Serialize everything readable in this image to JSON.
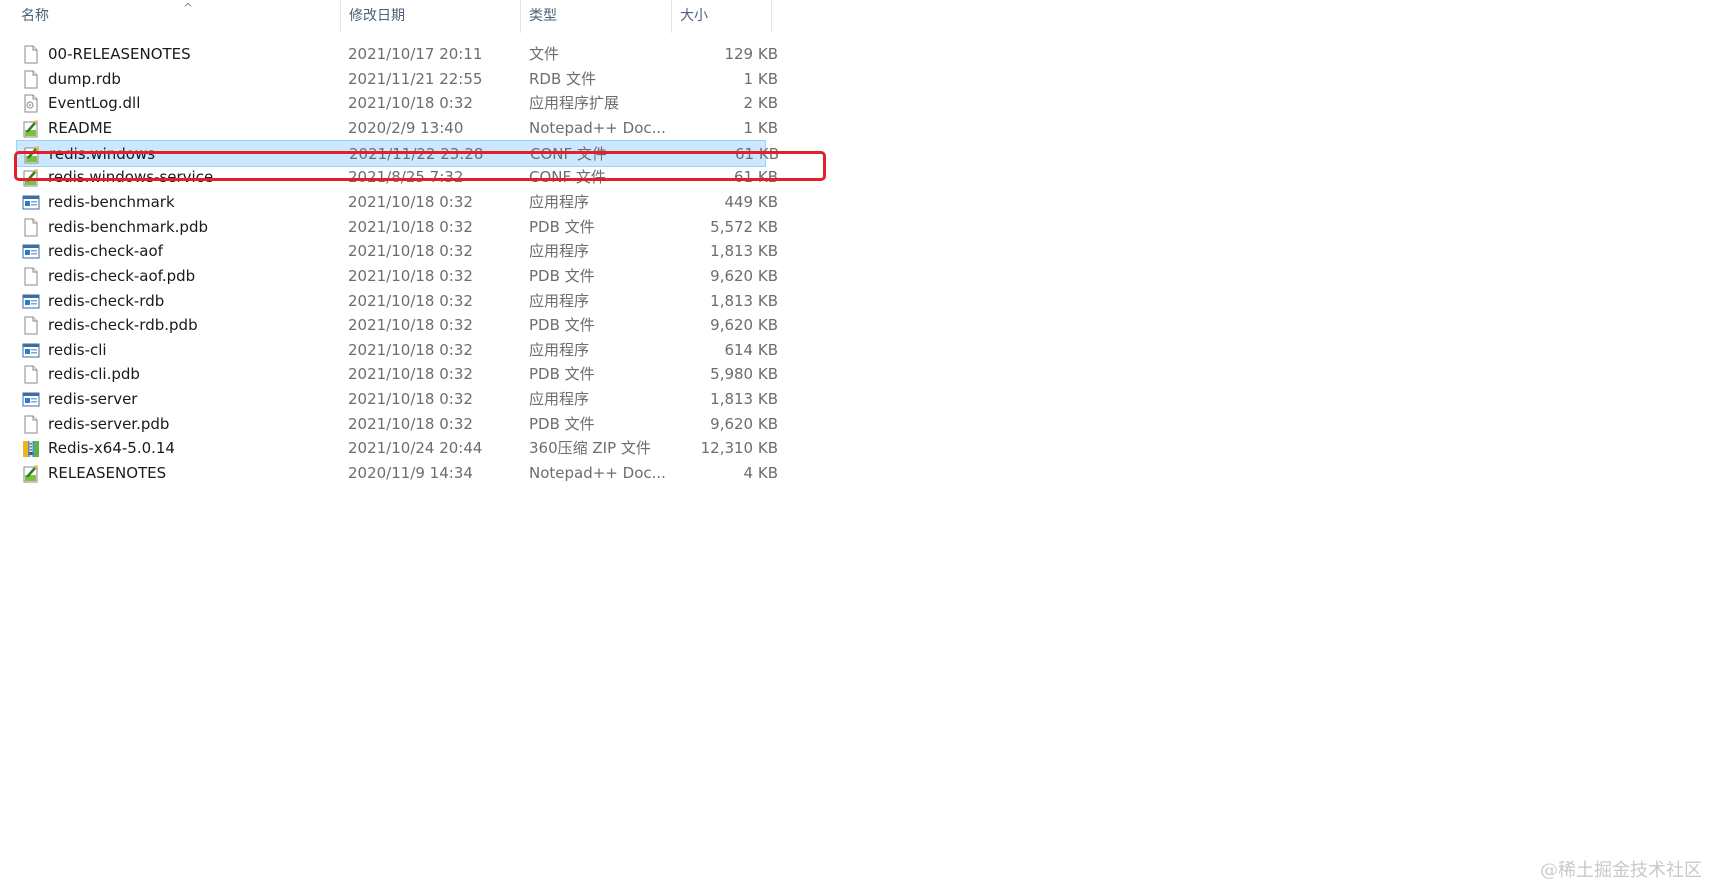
{
  "columns": {
    "name": "名称",
    "date": "修改日期",
    "type": "类型",
    "size": "大小"
  },
  "colors": {
    "selection_bg": "#cce8ff",
    "selection_border": "#99d1ff",
    "highlight_box": "#e0202a",
    "header_text": "#4c607a",
    "secondary_text": "#6d6d6d"
  },
  "files": [
    {
      "name": "00-RELEASENOTES",
      "date": "2021/10/17 20:11",
      "type": "文件",
      "size": "129 KB",
      "icon": "blank-file-icon"
    },
    {
      "name": "dump.rdb",
      "date": "2021/11/21 22:55",
      "type": "RDB 文件",
      "size": "1 KB",
      "icon": "blank-file-icon"
    },
    {
      "name": "EventLog.dll",
      "date": "2021/10/18 0:32",
      "type": "应用程序扩展",
      "size": "2 KB",
      "icon": "dll-file-icon"
    },
    {
      "name": "README",
      "date": "2020/2/9 13:40",
      "type": "Notepad++ Doc...",
      "size": "1 KB",
      "icon": "notepad-plus-plus-file-icon"
    },
    {
      "name": "redis.windows",
      "date": "2021/11/22 23:28",
      "type": "CONF 文件",
      "size": "61 KB",
      "icon": "notepad-plus-plus-file-icon",
      "selected": true
    },
    {
      "name": "redis.windows-service",
      "date": "2021/8/25 7:32",
      "type": "CONF 文件",
      "size": "61 KB",
      "icon": "notepad-plus-plus-file-icon"
    },
    {
      "name": "redis-benchmark",
      "date": "2021/10/18 0:32",
      "type": "应用程序",
      "size": "449 KB",
      "icon": "application-icon"
    },
    {
      "name": "redis-benchmark.pdb",
      "date": "2021/10/18 0:32",
      "type": "PDB 文件",
      "size": "5,572 KB",
      "icon": "blank-file-icon"
    },
    {
      "name": "redis-check-aof",
      "date": "2021/10/18 0:32",
      "type": "应用程序",
      "size": "1,813 KB",
      "icon": "application-icon"
    },
    {
      "name": "redis-check-aof.pdb",
      "date": "2021/10/18 0:32",
      "type": "PDB 文件",
      "size": "9,620 KB",
      "icon": "blank-file-icon"
    },
    {
      "name": "redis-check-rdb",
      "date": "2021/10/18 0:32",
      "type": "应用程序",
      "size": "1,813 KB",
      "icon": "application-icon"
    },
    {
      "name": "redis-check-rdb.pdb",
      "date": "2021/10/18 0:32",
      "type": "PDB 文件",
      "size": "9,620 KB",
      "icon": "blank-file-icon"
    },
    {
      "name": "redis-cli",
      "date": "2021/10/18 0:32",
      "type": "应用程序",
      "size": "614 KB",
      "icon": "application-icon"
    },
    {
      "name": "redis-cli.pdb",
      "date": "2021/10/18 0:32",
      "type": "PDB 文件",
      "size": "5,980 KB",
      "icon": "blank-file-icon"
    },
    {
      "name": "redis-server",
      "date": "2021/10/18 0:32",
      "type": "应用程序",
      "size": "1,813 KB",
      "icon": "application-icon"
    },
    {
      "name": "redis-server.pdb",
      "date": "2021/10/18 0:32",
      "type": "PDB 文件",
      "size": "9,620 KB",
      "icon": "blank-file-icon"
    },
    {
      "name": "Redis-x64-5.0.14",
      "date": "2021/10/24 20:44",
      "type": "360压缩 ZIP 文件",
      "size": "12,310 KB",
      "icon": "zip-archive-icon"
    },
    {
      "name": "RELEASENOTES",
      "date": "2020/11/9 14:34",
      "type": "Notepad++ Doc...",
      "size": "4 KB",
      "icon": "notepad-plus-plus-file-icon"
    }
  ],
  "watermark": "@稀土掘金技术社区"
}
